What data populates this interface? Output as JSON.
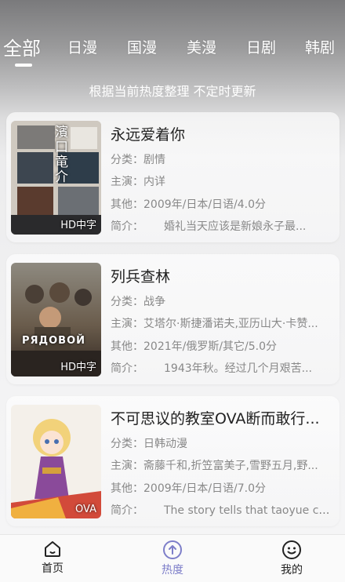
{
  "tabs": [
    {
      "label": "全部",
      "active": true
    },
    {
      "label": "日漫",
      "active": false
    },
    {
      "label": "国漫",
      "active": false
    },
    {
      "label": "美漫",
      "active": false
    },
    {
      "label": "日剧",
      "active": false
    },
    {
      "label": "韩剧",
      "active": false
    }
  ],
  "subtitle": "根据当前热度整理 不定时更新",
  "cards": [
    {
      "title": "永远爱着你",
      "category_key": "分类：",
      "category": "剧情",
      "cast_key": "主演：",
      "cast": "内详",
      "other_key": "其他：",
      "other": "2009年/日本/日语/4.0分",
      "intro_key": "简介：",
      "intro": "婚礼当天应该是新娘永子最...",
      "badge": "HD中字",
      "poster_text": "濱口竜介"
    },
    {
      "title": "列兵查林",
      "category_key": "分类：",
      "category": "战争",
      "cast_key": "主演：",
      "cast": "艾塔尔·斯捷潘诺夫,亚历山大·卡赞...",
      "other_key": "其他：",
      "other": "2021年/俄罗斯/其它/5.0分",
      "intro_key": "简介：",
      "intro": "1943年秋。经过几个月艰苦...",
      "badge": "HD中字",
      "poster_text": "РЯДОВОЙ"
    },
    {
      "title": "不可思议的教室OVA断而敢行...",
      "category_key": "分类：",
      "category": "日韩动漫",
      "cast_key": "主演：",
      "cast": "斋藤千和,折笠富美子,雪野五月,野...",
      "other_key": "其他：",
      "other": "2009年/日本/日语/7.0分",
      "intro_key": "简介：",
      "intro": "The story tells that taoyue co...",
      "badge": "OVA",
      "poster_text": ""
    }
  ],
  "nav": [
    {
      "label": "首页",
      "icon": "home-icon",
      "active": false
    },
    {
      "label": "热度",
      "icon": "upload-circle-icon",
      "active": true
    },
    {
      "label": "我的",
      "icon": "smiley-icon",
      "active": false
    }
  ],
  "colors": {
    "accent": "#7d7ec9",
    "text": "#222222",
    "muted": "#888888"
  }
}
